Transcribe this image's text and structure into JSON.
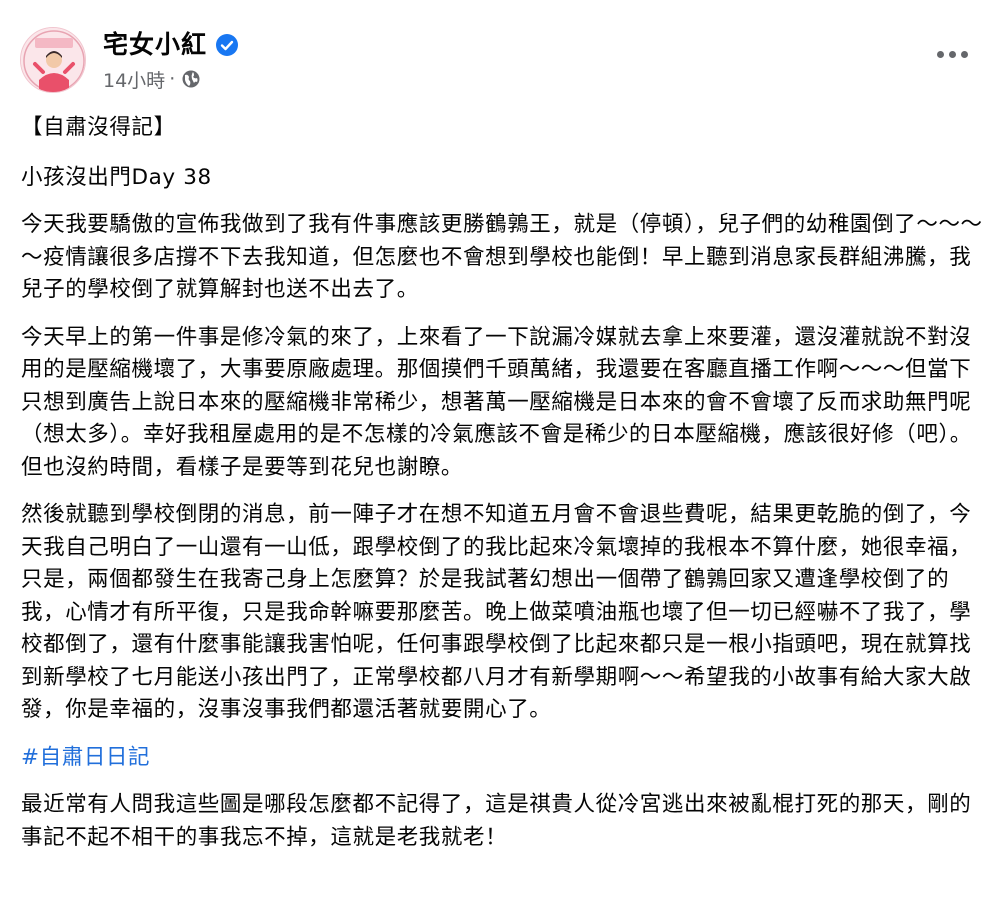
{
  "post": {
    "author": {
      "name": "宅女小紅",
      "verified": true
    },
    "meta": {
      "time": "14小時",
      "separator": "·",
      "audience_icon": "globe-icon"
    },
    "more_icon": "more-options-icon",
    "paragraphs": [
      "【自肅沒得記】",
      "小孩沒出門Day 38",
      "今天我要驕傲的宣佈我做到了我有件事應該更勝鶴鶉王，就是（停頓），兒子們的幼稚園倒了～～～～疫情讓很多店撐不下去我知道，但怎麼也不會想到學校也能倒！早上聽到消息家長群組沸騰，我兒子的學校倒了就算解封也送不出去了。",
      "今天早上的第一件事是修冷氣的來了，上來看了一下說漏冷媒就去拿上來要灌，還沒灌就說不對沒用的是壓縮機壞了，大事要原廠處理。那個摸們千頭萬緒，我還要在客廳直播工作啊～～～但當下只想到廣告上說日本來的壓縮機非常稀少，想著萬一壓縮機是日本來的會不會壞了反而求助無門呢（想太多）。幸好我租屋處用的是不怎樣的冷氣應該不會是稀少的日本壓縮機，應該很好修（吧）。但也沒約時間，看樣子是要等到花兒也謝瞭。",
      "然後就聽到學校倒閉的消息，前一陣子才在想不知道五月會不會退些費呢，結果更乾脆的倒了，今天我自己明白了一山還有一山低，跟學校倒了的我比起來冷氣壞掉的我根本不算什麼，她很幸福，只是，兩個都發生在我寄己身上怎麼算？於是我試著幻想出一個帶了鶴鶉回家又遭逢學校倒了的我，心情才有所平復，只是我命幹嘛要那麼苦。晚上做菜噴油瓶也壞了但一切已經嚇不了我了，學校都倒了，還有什麼事能讓我害怕呢，任何事跟學校倒了比起來都只是一根小指頭吧，現在就算找到新學校了七月能送小孩出門了，正常學校都八月才有新學期啊～～希望我的小故事有給大家大啟發，你是幸福的，沒事沒事我們都還活著就要開心了。"
    ],
    "hashtag": "#自肅日日記",
    "closing": "最近常有人問我這些圖是哪段怎麼都不記得了，這是祺貴人從冷宮逃出來被亂棍打死的那天，剛的事記不起不相干的事我忘不掉，這就是老我就老！",
    "colors": {
      "hashtag": "#216fdb",
      "verified": "#1877f2",
      "secondary_text": "#65676b"
    }
  }
}
